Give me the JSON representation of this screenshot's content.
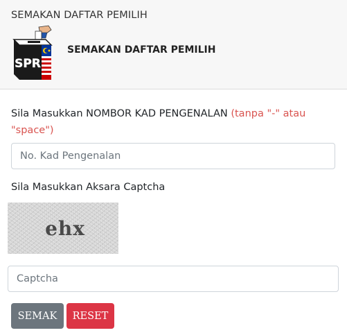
{
  "header": {
    "title": "SEMAKAN DAFTAR PEMILIH",
    "heading": "SEMAKAN DAFTAR PEMILIH",
    "logo_text": "SPR"
  },
  "form": {
    "ic_label": "Sila Masukkan NOMBOR KAD PENGENALAN",
    "ic_hint": "(tanpa \"-\" atau \"space\")",
    "ic_placeholder": "No. Kad Pengenalan",
    "captcha_label": "Sila Masukkan Aksara Captcha",
    "captcha_text": "ehx",
    "captcha_placeholder": "Captcha",
    "semak_label": "SEMAK",
    "reset_label": "RESET"
  },
  "colors": {
    "hint": "#d9534f",
    "semak_button": "#6c757d",
    "reset_button": "#dc3545"
  }
}
